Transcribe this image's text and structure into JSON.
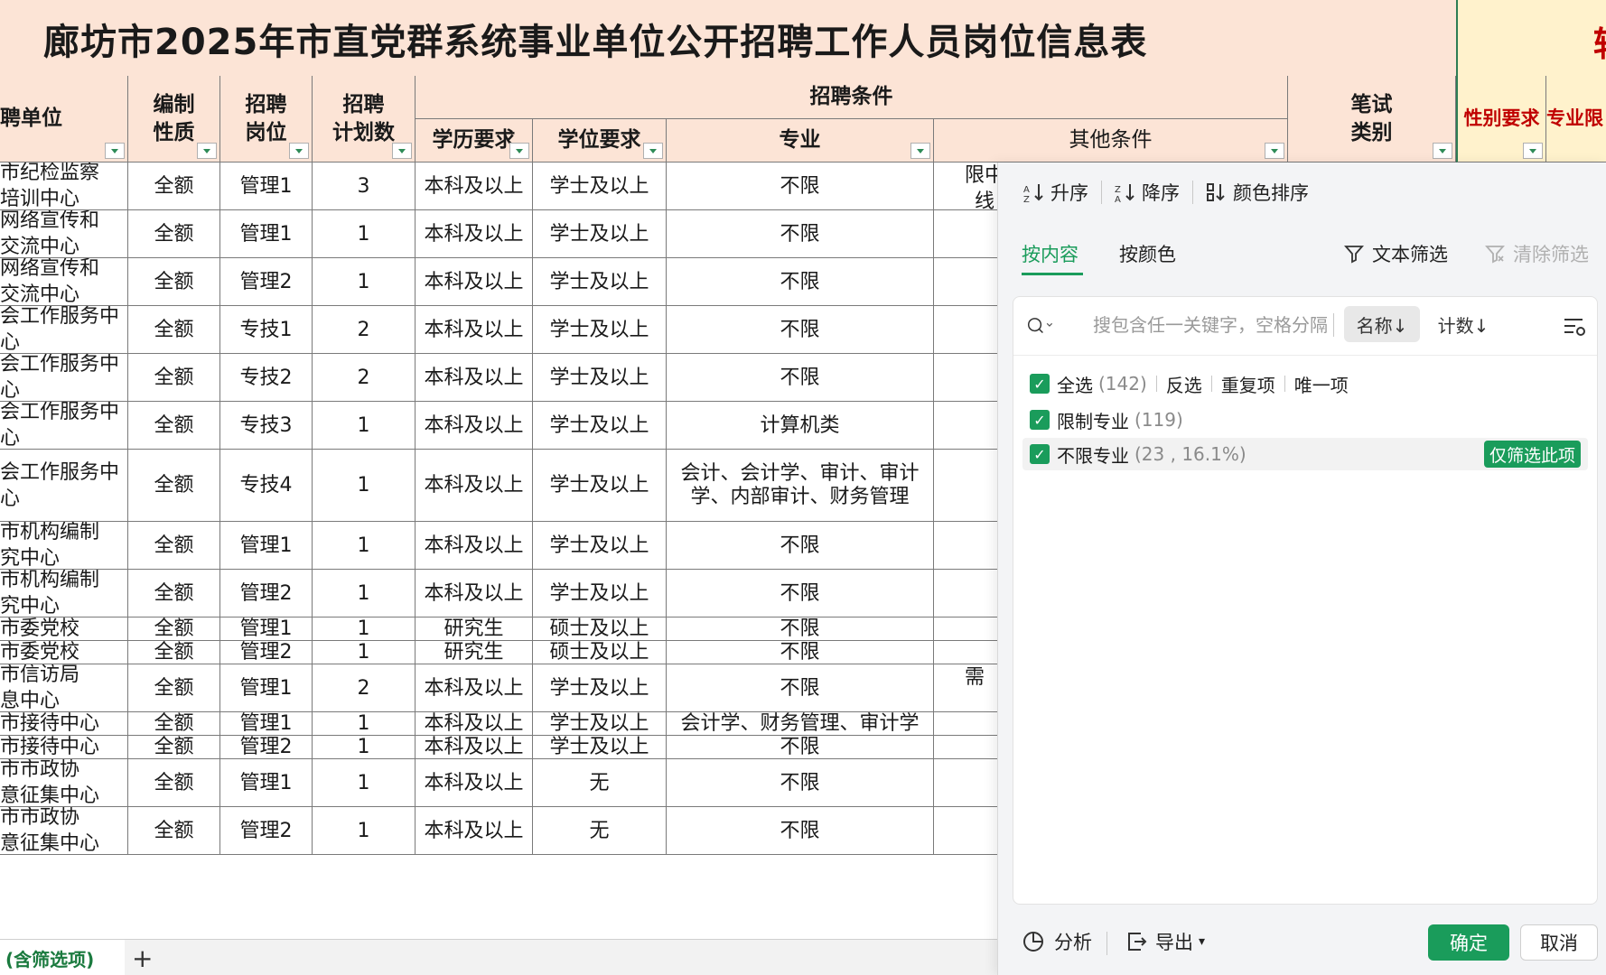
{
  "title": "廊坊市2025年市直党群系统事业单位公开招聘工作人员岗位信息表",
  "title_right_glyph": "辅",
  "headers": {
    "unit": "聘单位",
    "nature": "编制\n性质",
    "post": "招聘\n岗位",
    "plan": "招聘\n计划数",
    "conditions": "招聘条件",
    "edu": "学历要求",
    "degree": "学位要求",
    "major": "专业",
    "other": "其他条件",
    "exam": "笔试\n类别",
    "gender": "性别要求",
    "major_limit": "专业限"
  },
  "rows": [
    {
      "unit": "市纪检监察\n培训中心",
      "nature": "全额",
      "post": "管理1",
      "plan": "3",
      "edu": "本科及以上",
      "degree": "学士及以上",
      "major": "不限",
      "other": "限中\n线"
    },
    {
      "unit": "网络宣传和\n交流中心",
      "nature": "全额",
      "post": "管理1",
      "plan": "1",
      "edu": "本科及以上",
      "degree": "学士及以上",
      "major": "不限",
      "other": ""
    },
    {
      "unit": "网络宣传和\n交流中心",
      "nature": "全额",
      "post": "管理2",
      "plan": "1",
      "edu": "本科及以上",
      "degree": "学士及以上",
      "major": "不限",
      "other": ""
    },
    {
      "unit": "会工作服务中\n心",
      "nature": "全额",
      "post": "专技1",
      "plan": "2",
      "edu": "本科及以上",
      "degree": "学士及以上",
      "major": "不限",
      "other": ""
    },
    {
      "unit": "会工作服务中\n心",
      "nature": "全额",
      "post": "专技2",
      "plan": "2",
      "edu": "本科及以上",
      "degree": "学士及以上",
      "major": "不限",
      "other": ""
    },
    {
      "unit": "会工作服务中\n心",
      "nature": "全额",
      "post": "专技3",
      "plan": "1",
      "edu": "本科及以上",
      "degree": "学士及以上",
      "major": "计算机类",
      "other": ""
    },
    {
      "unit": "会工作服务中\n心",
      "nature": "全额",
      "post": "专技4",
      "plan": "1",
      "edu": "本科及以上",
      "degree": "学士及以上",
      "major": "会计、会计学、审计、审计学、内部审计、财务管理",
      "other": ""
    },
    {
      "unit": "市机构编制\n究中心",
      "nature": "全额",
      "post": "管理1",
      "plan": "1",
      "edu": "本科及以上",
      "degree": "学士及以上",
      "major": "不限",
      "other": ""
    },
    {
      "unit": "市机构编制\n究中心",
      "nature": "全额",
      "post": "管理2",
      "plan": "1",
      "edu": "本科及以上",
      "degree": "学士及以上",
      "major": "不限",
      "other": ""
    },
    {
      "unit": "市委党校",
      "nature": "全额",
      "post": "管理1",
      "plan": "1",
      "edu": "研究生",
      "degree": "硕士及以上",
      "major": "不限",
      "other": ""
    },
    {
      "unit": "市委党校",
      "nature": "全额",
      "post": "管理2",
      "plan": "1",
      "edu": "研究生",
      "degree": "硕士及以上",
      "major": "不限",
      "other": ""
    },
    {
      "unit": "市信访局\n息中心",
      "nature": "全额",
      "post": "管理1",
      "plan": "2",
      "edu": "本科及以上",
      "degree": "学士及以上",
      "major": "不限",
      "other": "需"
    },
    {
      "unit": "市接待中心",
      "nature": "全额",
      "post": "管理1",
      "plan": "1",
      "edu": "本科及以上",
      "degree": "学士及以上",
      "major": "会计学、财务管理、审计学",
      "other": ""
    },
    {
      "unit": "市接待中心",
      "nature": "全额",
      "post": "管理2",
      "plan": "1",
      "edu": "本科及以上",
      "degree": "学士及以上",
      "major": "不限",
      "other": ""
    },
    {
      "unit": "市市政协\n意征集中心",
      "nature": "全额",
      "post": "管理1",
      "plan": "1",
      "edu": "本科及以上",
      "degree": "无",
      "major": "不限",
      "other": ""
    },
    {
      "unit": "市市政协\n意征集中心",
      "nature": "全额",
      "post": "管理2",
      "plan": "1",
      "edu": "本科及以上",
      "degree": "无",
      "major": "不限",
      "other": ""
    }
  ],
  "sheet_tab": "(含筛选项)",
  "add_sheet": "+",
  "panel": {
    "sort_asc": "升序",
    "sort_desc": "降序",
    "color_sort": "颜色排序",
    "tab_content": "按内容",
    "tab_color": "按颜色",
    "text_filter": "文本筛选",
    "clear_filter": "清除筛选",
    "search_placeholder": "搜包含任一关键字，空格分隔",
    "sort_name": "名称↓",
    "sort_count": "计数↓",
    "select_all": "全选",
    "select_all_count": "(142)",
    "invert": "反选",
    "duplicates": "重复项",
    "unique": "唯一项",
    "items": [
      {
        "label": "限制专业",
        "count": "(119)"
      },
      {
        "label": "不限专业",
        "count": "(23 , 16.1%)"
      }
    ],
    "only_this": "仅筛选此项",
    "analyze": "分析",
    "export": "导出",
    "ok": "确定",
    "cancel": "取消"
  },
  "colors": {
    "accent": "#1a9c5b",
    "header_bg": "#fce4d6",
    "yellow_bg": "#fff2cc",
    "red": "#c00000"
  }
}
